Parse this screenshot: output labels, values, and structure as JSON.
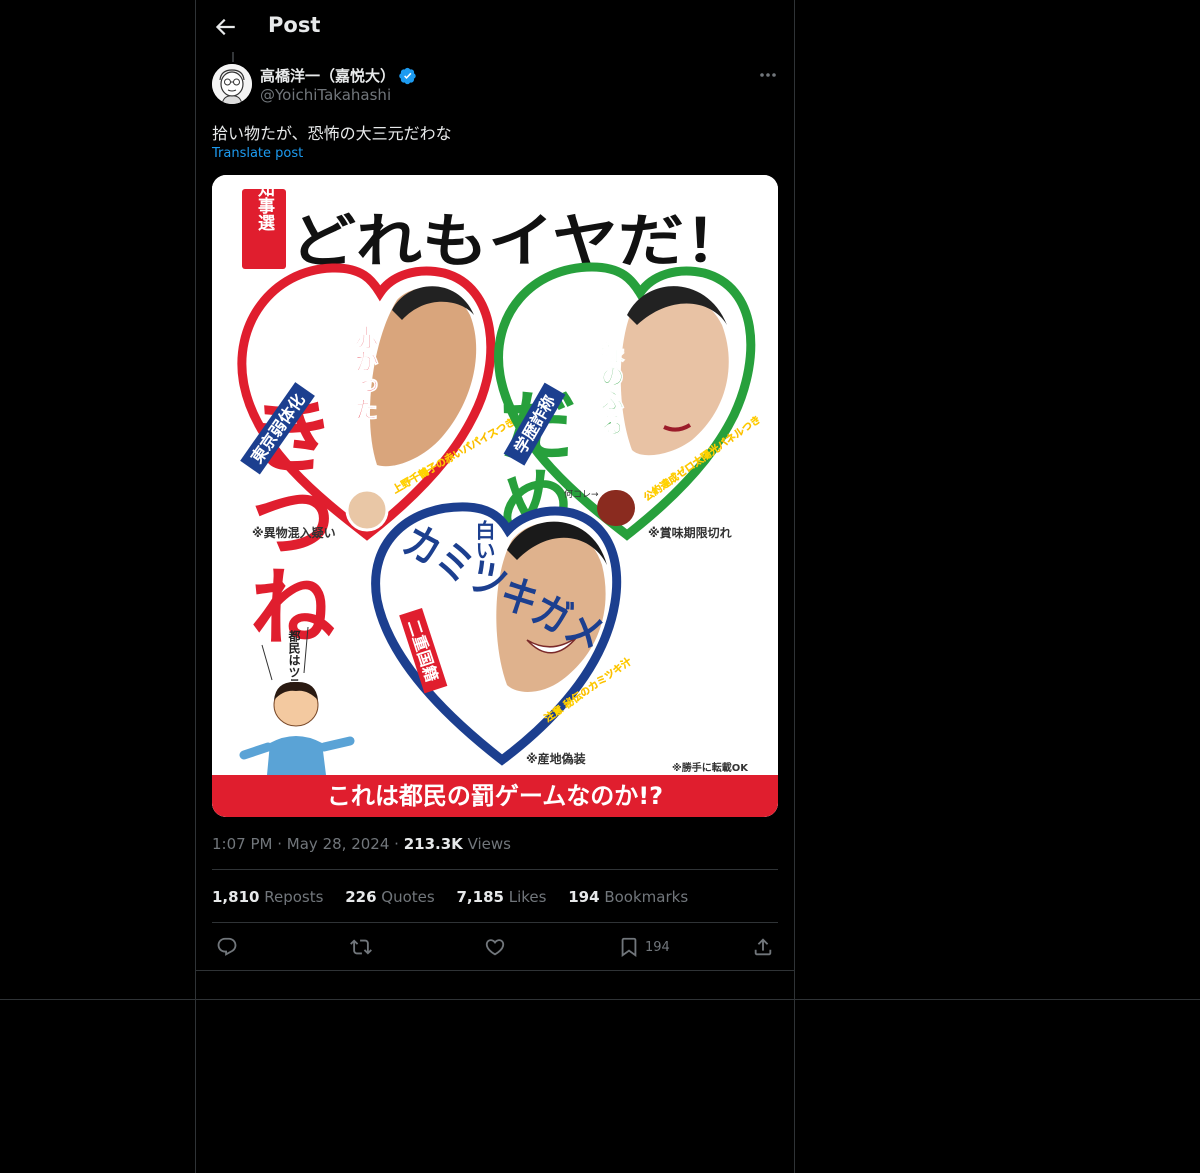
{
  "header": {
    "title": "Post"
  },
  "author": {
    "name": "高橋洋一（嘉悦大）",
    "handle": "@YoichiTakahashi"
  },
  "tweet": {
    "text": "拾い物たが、恐怖の大三元だわな",
    "translate_label": "Translate post"
  },
  "image": {
    "badge": "都知事選",
    "title": "どれもイヤだ！",
    "footer": "これは都民の罰ゲームなのか!?",
    "reprint_note": "※勝手に転載OK",
    "left": {
      "big": "きつね",
      "sub": "赤かった",
      "band": "東京弱体化",
      "note": "※異物混入疑い",
      "small": "上野千鶴子の赤いパパイスつき"
    },
    "right": {
      "big": "だぬき",
      "sub": "緑のふる",
      "band": "学歴詐称",
      "note": "※賞味期限切れ",
      "small": "公約達成ゼロ太陽光パネルつき",
      "tiny": "何コレ→"
    },
    "bottom": {
      "big": "カミツキガメ",
      "sub": "白い",
      "band": "二重国籍",
      "note": "※産地偽装",
      "small": "注意 秘伝のカミツキ汁"
    },
    "citizen_speech": "都民はツラいよ"
  },
  "meta": {
    "time": "1:07 PM",
    "date": "May 28, 2024",
    "dot": "·",
    "views_count": "213.3K",
    "views_label": "Views"
  },
  "stats": [
    {
      "count": "1,810",
      "label": "Reposts"
    },
    {
      "count": "226",
      "label": "Quotes"
    },
    {
      "count": "7,185",
      "label": "Likes"
    },
    {
      "count": "194",
      "label": "Bookmarks"
    }
  ],
  "actions": {
    "bookmark_count": "194"
  },
  "colors": {
    "accent": "#1d9bf0",
    "verified": "#1d9bf0",
    "red": "#e01e2e",
    "green": "#27a03c",
    "blue": "#1c3f8f"
  }
}
